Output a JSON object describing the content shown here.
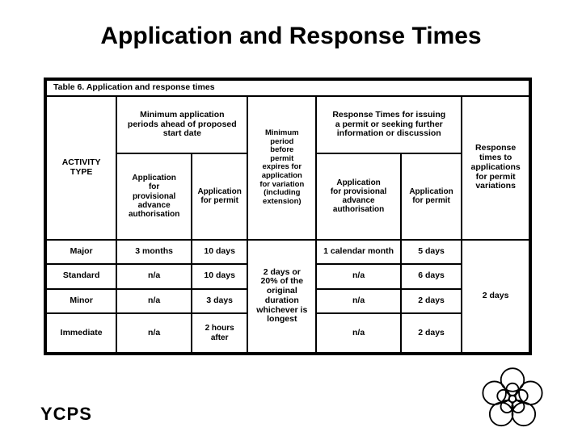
{
  "slide": {
    "title": "Application and Response Times",
    "footer_logo": "YCPS"
  },
  "table": {
    "caption": "Table 6.  Application and response times",
    "headers": {
      "activity_type": "ACTIVITY\nTYPE",
      "min_application_periods": "Minimum application periods ahead of proposed start date",
      "min_period_variation": "Minimum period before permit expires for application for variation (including extension)",
      "response_times_issuing": "Response Times for issuing a permit or seeking further information or discussion",
      "response_times_variations": "Response times to applications for permit variations"
    },
    "subheaders": {
      "app_provisional_advance": "Application for provisional advance authorisation",
      "app_permit": "Application for permit",
      "app_provisional_advance_2": "Application for provisional advance authorisation",
      "app_permit_2": "Application for permit"
    },
    "variation_period": "2 days or 20% of the original duration whichever is longest",
    "rows": [
      {
        "activity": "Major",
        "min_app_provisional": "3 months",
        "min_app_permit": "10 days",
        "resp_provisional": "1 calendar month",
        "resp_permit": "5 days",
        "resp_variation": "2 days"
      },
      {
        "activity": "Standard",
        "min_app_provisional": "n/a",
        "min_app_permit": "10 days",
        "resp_provisional": "n/a",
        "resp_permit": "6 days",
        "resp_variation": ""
      },
      {
        "activity": "Minor",
        "min_app_provisional": "n/a",
        "min_app_permit": "3 days",
        "resp_provisional": "n/a",
        "resp_permit": "2 days",
        "resp_variation": ""
      },
      {
        "activity": "Immediate",
        "min_app_provisional": "n/a",
        "min_app_permit": "2 hours after",
        "resp_provisional": "n/a",
        "resp_permit": "2 days",
        "resp_variation": ""
      }
    ]
  },
  "colors": {
    "text": "#000000",
    "background": "#ffffff",
    "border": "#000000"
  }
}
